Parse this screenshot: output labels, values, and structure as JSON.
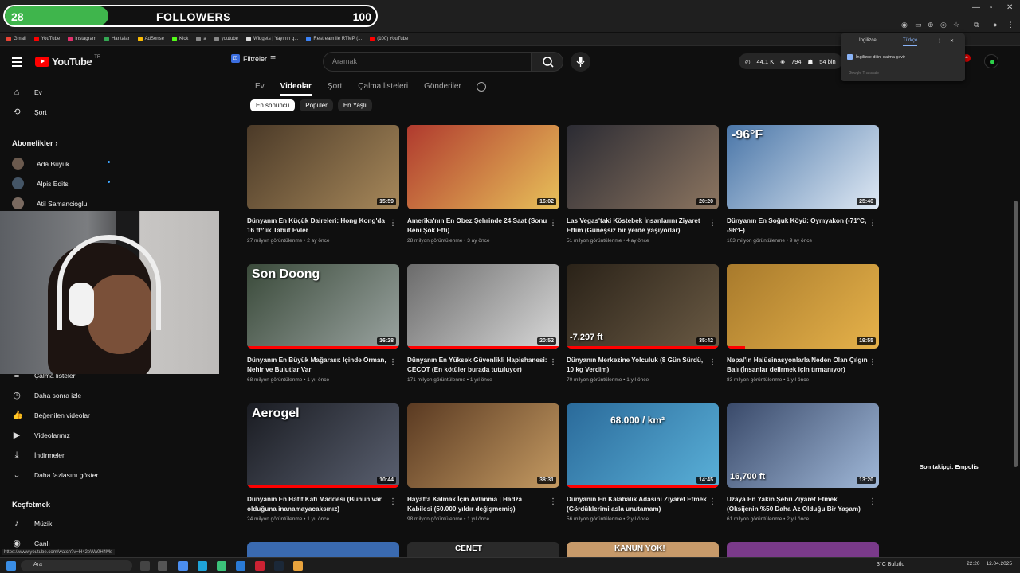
{
  "overlay": {
    "current": "28",
    "label": "FOLLOWERS",
    "goal": "100",
    "progress_fraction": 0.28,
    "last_follower": "Son takipçi: Empolis"
  },
  "browser": {
    "tab_text": "...",
    "bookmarks": [
      {
        "label": "Gmail",
        "color": "#ea4335"
      },
      {
        "label": "YouTube",
        "color": "#ff0000"
      },
      {
        "label": "Instagram",
        "color": "#e1306c"
      },
      {
        "label": "Haritalar",
        "color": "#34a853"
      },
      {
        "label": "AdSense",
        "color": "#fbbc04"
      },
      {
        "label": "Kick",
        "color": "#53fc18"
      },
      {
        "label": "a",
        "color": "#888888"
      },
      {
        "label": "youtube",
        "color": "#888888"
      },
      {
        "label": "Widgets | Yayının g...",
        "color": "#dddddd"
      },
      {
        "label": "Restream ile RTMP (...",
        "color": "#3b82f6"
      },
      {
        "label": "(100) YouTube",
        "color": "#ff0000"
      }
    ],
    "status_url": "https://www.youtube.com/watch?v=H42eWa0H4Ms"
  },
  "header": {
    "logo_text": "YouTube",
    "country": "TR",
    "filters_label": "Filtreler",
    "search_placeholder": "Aramak",
    "stats": {
      "views": "44,1 K",
      "likes": "794",
      "subs": "54 bin"
    },
    "notif_count": "4"
  },
  "translate_popup": {
    "tab_en": "İngilizce",
    "tab_tr": "Türkçe",
    "option": "İngilizce dilini daima çevir",
    "footer": "Google Translate"
  },
  "sidebar": {
    "home": "Ev",
    "shorts": "Şort",
    "subscriptions_title": "Abonelikler",
    "subscriptions": [
      {
        "name": "Ada Büyük",
        "color": "#6b5a4e"
      },
      {
        "name": "Alpis Edits",
        "color": "#445566"
      },
      {
        "name": "Atil Samancioglu",
        "color": "#7a6a60"
      }
    ],
    "playlists": "Çalma listeleri",
    "watch_later": "Daha sonra izle",
    "liked": "Beğenilen videolar",
    "your_videos": "Videolarınız",
    "downloads": "İndirmeler",
    "show_more": "Daha fazlasını göster",
    "explore_title": "Keşfetmek",
    "music": "Müzik",
    "live": "Canlı"
  },
  "channel_tabs": [
    "Ev",
    "Videolar",
    "Şort",
    "Çalma listeleri",
    "Gönderiler"
  ],
  "active_tab": "Videolar",
  "chips": [
    "En sonuncu",
    "Popüler",
    "En Yaşlı"
  ],
  "videos": [
    {
      "title": "Dünyanın En Küçük Daireleri: Hong Kong'da 16 ft²'lik Tabut Evler",
      "views": "27 milyon görüntülenme",
      "age": "2 ay önce",
      "duration": "15:59",
      "progress": 0.0,
      "colors": [
        "#4b3a28",
        "#a7885a"
      ],
      "overlay": ""
    },
    {
      "title": "Amerika'nın En Obez Şehrinde 24 Saat (Sonu Beni Şok Etti)",
      "views": "28 milyon görüntülenme",
      "age": "3 ay önce",
      "duration": "16:02",
      "progress": 0.0,
      "colors": [
        "#b03a2e",
        "#e8c15a"
      ],
      "overlay": ""
    },
    {
      "title": "Las Vegas'taki Köstebek İnsanlarını Ziyaret Ettim (Güneşsiz bir yerde yaşıyorlar)",
      "views": "51 milyon görüntülenme",
      "age": "4 ay önce",
      "duration": "20:20",
      "progress": 0.0,
      "colors": [
        "#2b2b33",
        "#8c7560"
      ],
      "overlay": ""
    },
    {
      "title": "Dünyanın En Soğuk Köyü: Oymyakon (-71°C, -96°F)",
      "views": "103 milyon görüntülenme",
      "age": "9 ay önce",
      "duration": "25:40",
      "progress": 0.0,
      "colors": [
        "#4a76a8",
        "#dfe9f4"
      ],
      "overlay": "-96°F"
    },
    {
      "title": "Dünyanın En Büyük Mağarası: İçinde Orman, Nehir ve Bulutlar Var",
      "views": "68 milyon görüntülenme",
      "age": "1 yıl önce",
      "duration": "16:28",
      "progress": 1.0,
      "colors": [
        "#3a4a3a",
        "#9aa3a0"
      ],
      "overlay": "Son Doong"
    },
    {
      "title": "Dünyanın En Yüksek Güvenlikli Hapishanesi: CECOT (En kötüler burada tutuluyor)",
      "views": "171 milyon görüntülenme",
      "age": "1 yıl önce",
      "duration": "20:52",
      "progress": 1.0,
      "colors": [
        "#6b6b6b",
        "#d8d8d8"
      ],
      "overlay": ""
    },
    {
      "title": "Dünyanın Merkezine Yolculuk (8 Gün Sürdü, 10 kg Verdim)",
      "views": "70 milyon görüntülenme",
      "age": "1 yıl önce",
      "duration": "35:42",
      "progress": 1.0,
      "colors": [
        "#2a2218",
        "#6a5a44"
      ],
      "overlay": "-7,297 ft"
    },
    {
      "title": "Nepal'in Halüsinasyonlarla Neden Olan Çılgın Balı (İnsanlar delirmek için tırmanıyor)",
      "views": "83 milyon görüntülenme",
      "age": "1 yıl önce",
      "duration": "19:55",
      "progress": 0.12,
      "colors": [
        "#a87a2c",
        "#e6b24a"
      ],
      "overlay": ""
    },
    {
      "title": "Dünyanın En Hafif Katı Maddesi (Bunun var olduğuna inanamayacaksınız)",
      "views": "24 milyon görüntülenme",
      "age": "1 yıl önce",
      "duration": "10:44",
      "progress": 1.0,
      "colors": [
        "#1a1c22",
        "#5a6070"
      ],
      "overlay": "Aerogel"
    },
    {
      "title": "Hayatta Kalmak İçin Avlanma | Hadza Kabilesi (50.000 yıldır değişmemiş)",
      "views": "98 milyon görüntülenme",
      "age": "1 yıl önce",
      "duration": "38:31",
      "progress": 0.0,
      "colors": [
        "#5a3a22",
        "#c49a62"
      ],
      "overlay": ""
    },
    {
      "title": "Dünyanın En Kalabalık Adasını Ziyaret Etmek (Gördüklerimi asla unutamam)",
      "views": "56 milyon görüntülenme",
      "age": "2 yıl önce",
      "duration": "14:45",
      "progress": 1.0,
      "colors": [
        "#2a6a9a",
        "#5ab0d8"
      ],
      "overlay": "68.000 / km²"
    },
    {
      "title": "Uzaya En Yakın Şehri Ziyaret Etmek (Oksijenin %50 Daha Az Olduğu Bir Yaşam)",
      "views": "61 milyon görüntülenme",
      "age": "2 yıl önce",
      "duration": "13:20",
      "progress": 0.0,
      "colors": [
        "#3a4a6a",
        "#a0b8d8"
      ],
      "overlay": "16,700 ft"
    }
  ],
  "next_row_overlays": [
    "",
    "CENET",
    "KANUN YOK!",
    ""
  ],
  "taskbar": {
    "search": "Ara",
    "weather": "3°C Bulutlu",
    "time": "22:20",
    "date": "12.04.2025"
  }
}
